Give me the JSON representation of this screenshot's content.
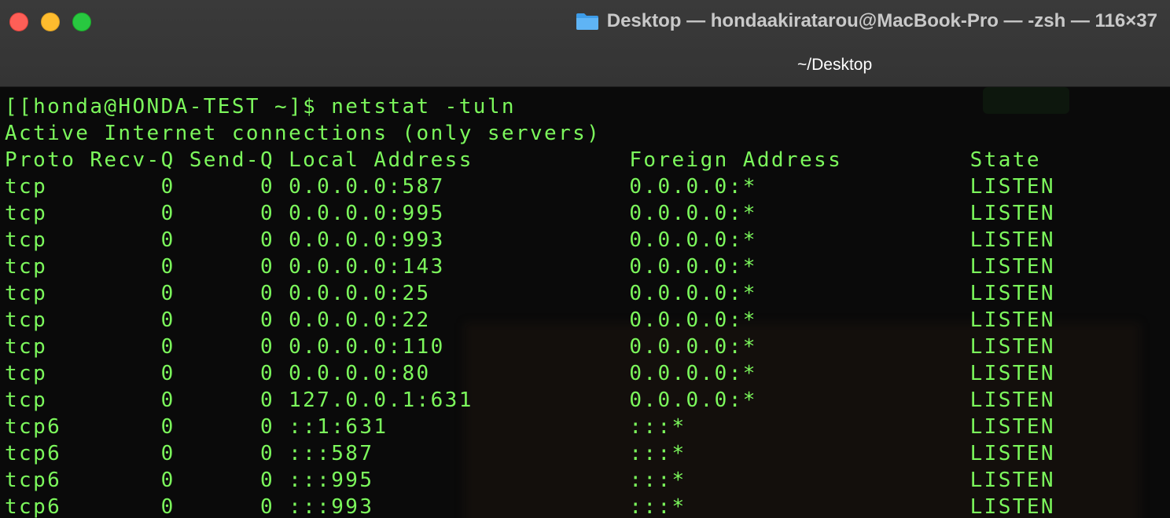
{
  "window": {
    "title": "Desktop — hondaakiratarou@MacBook-Pro — -zsh — 116×37",
    "tab_title": "~/Desktop",
    "folder_icon": "folder-icon",
    "colors": {
      "terminal_text": "#7cf85c",
      "terminal_bg": "#0a0a0a",
      "titlebar_bg": "#363636",
      "close": "#fe5f57",
      "minimize": "#febc2e",
      "zoom": "#28c840"
    }
  },
  "terminal": {
    "prompt_line": "[[honda@HONDA-TEST ~]$ netstat -tuln",
    "header_line": "Active Internet connections (only servers)",
    "columns_line": "Proto Recv-Q Send-Q Local Address           Foreign Address         State",
    "columns": [
      "Proto",
      "Recv-Q",
      "Send-Q",
      "Local Address",
      "Foreign Address",
      "State"
    ],
    "rows": [
      [
        "tcp",
        "0",
        "0",
        "0.0.0.0:587",
        "0.0.0.0:*",
        "LISTEN"
      ],
      [
        "tcp",
        "0",
        "0",
        "0.0.0.0:995",
        "0.0.0.0:*",
        "LISTEN"
      ],
      [
        "tcp",
        "0",
        "0",
        "0.0.0.0:993",
        "0.0.0.0:*",
        "LISTEN"
      ],
      [
        "tcp",
        "0",
        "0",
        "0.0.0.0:143",
        "0.0.0.0:*",
        "LISTEN"
      ],
      [
        "tcp",
        "0",
        "0",
        "0.0.0.0:25",
        "0.0.0.0:*",
        "LISTEN"
      ],
      [
        "tcp",
        "0",
        "0",
        "0.0.0.0:22",
        "0.0.0.0:*",
        "LISTEN"
      ],
      [
        "tcp",
        "0",
        "0",
        "0.0.0.0:110",
        "0.0.0.0:*",
        "LISTEN"
      ],
      [
        "tcp",
        "0",
        "0",
        "0.0.0.0:80",
        "0.0.0.0:*",
        "LISTEN"
      ],
      [
        "tcp",
        "0",
        "0",
        "127.0.0.1:631",
        "0.0.0.0:*",
        "LISTEN"
      ],
      [
        "tcp6",
        "0",
        "0",
        "::1:631",
        ":::*",
        "LISTEN"
      ],
      [
        "tcp6",
        "0",
        "0",
        ":::587",
        ":::*",
        "LISTEN"
      ],
      [
        "tcp6",
        "0",
        "0",
        ":::995",
        ":::*",
        "LISTEN"
      ],
      [
        "tcp6",
        "0",
        "0",
        ":::993",
        ":::*",
        "LISTEN"
      ]
    ],
    "row_lines": [
      "tcp        0      0 0.0.0.0:587             0.0.0.0:*               LISTEN",
      "tcp        0      0 0.0.0.0:995             0.0.0.0:*               LISTEN",
      "tcp        0      0 0.0.0.0:993             0.0.0.0:*               LISTEN",
      "tcp        0      0 0.0.0.0:143             0.0.0.0:*               LISTEN",
      "tcp        0      0 0.0.0.0:25              0.0.0.0:*               LISTEN",
      "tcp        0      0 0.0.0.0:22              0.0.0.0:*               LISTEN",
      "tcp        0      0 0.0.0.0:110             0.0.0.0:*               LISTEN",
      "tcp        0      0 0.0.0.0:80              0.0.0.0:*               LISTEN",
      "tcp        0      0 127.0.0.1:631           0.0.0.0:*               LISTEN",
      "tcp6       0      0 ::1:631                 :::*                    LISTEN",
      "tcp6       0      0 :::587                  :::*                    LISTEN",
      "tcp6       0      0 :::995                  :::*                    LISTEN",
      "tcp6       0      0 :::993                  :::*                    LISTEN"
    ]
  }
}
